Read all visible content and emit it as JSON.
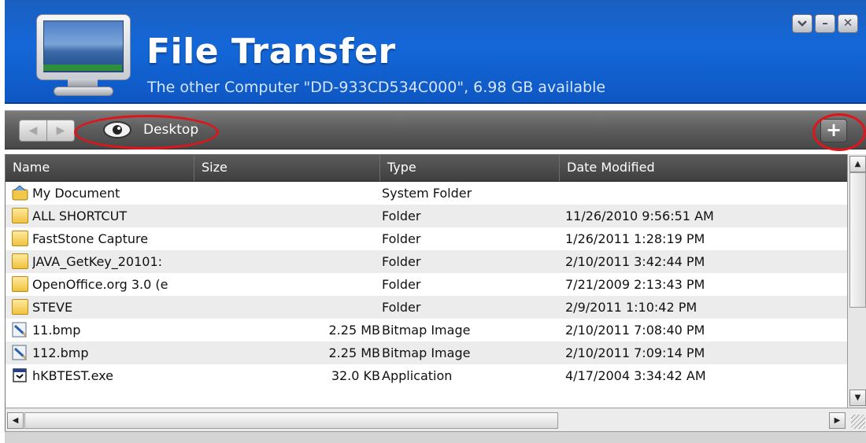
{
  "window": {
    "title": "File Transfer",
    "subtitle": "The other Computer \"DD-933CD534C000\", 6.98 GB available",
    "buttons": {
      "menu_icon": "chevron-down-icon",
      "minimize": "–",
      "close": "✕"
    }
  },
  "toolbar": {
    "back_icon": "◀",
    "forward_icon": "▶",
    "location_icon": "eye-icon",
    "location": "Desktop",
    "add_label": "+"
  },
  "columns": [
    "Name",
    "Size",
    "Type",
    "Date Modified"
  ],
  "files": [
    {
      "icon": "system-folder-icon",
      "name": "My Document",
      "size": "",
      "type": "System Folder",
      "date": ""
    },
    {
      "icon": "folder-icon",
      "name": "ALL SHORTCUT",
      "size": "",
      "type": "Folder",
      "date": "11/26/2010 9:56:51 AM"
    },
    {
      "icon": "folder-icon",
      "name": "FastStone Capture",
      "size": "",
      "type": "Folder",
      "date": "1/26/2011 1:28:19 PM"
    },
    {
      "icon": "folder-icon",
      "name": "JAVA_GetKey_20101:",
      "size": "",
      "type": "Folder",
      "date": "2/10/2011 3:42:44 PM"
    },
    {
      "icon": "folder-icon",
      "name": "OpenOffice.org 3.0 (e",
      "size": "",
      "type": "Folder",
      "date": "7/21/2009 2:13:43 PM"
    },
    {
      "icon": "folder-icon",
      "name": "STEVE",
      "size": "",
      "type": "Folder",
      "date": "2/9/2011 1:10:42 PM"
    },
    {
      "icon": "bitmap-icon",
      "name": "11.bmp",
      "size": "2.25 MB",
      "type": "Bitmap Image",
      "date": "2/10/2011 7:08:40 PM"
    },
    {
      "icon": "bitmap-icon",
      "name": "112.bmp",
      "size": "2.25 MB",
      "type": "Bitmap Image",
      "date": "2/10/2011 7:09:14 PM"
    },
    {
      "icon": "application-icon",
      "name": "hKBTEST.exe",
      "size": "32.0 KB",
      "type": "Application",
      "date": "4/17/2004 3:34:42 AM"
    }
  ],
  "scroll": {
    "up": "▲",
    "down": "▼",
    "left": "◀",
    "right": "▶"
  },
  "colors": {
    "header_blue": "#1467d8",
    "toolbar_gray": "#5e5e5e",
    "highlight_red": "#e0151a"
  }
}
